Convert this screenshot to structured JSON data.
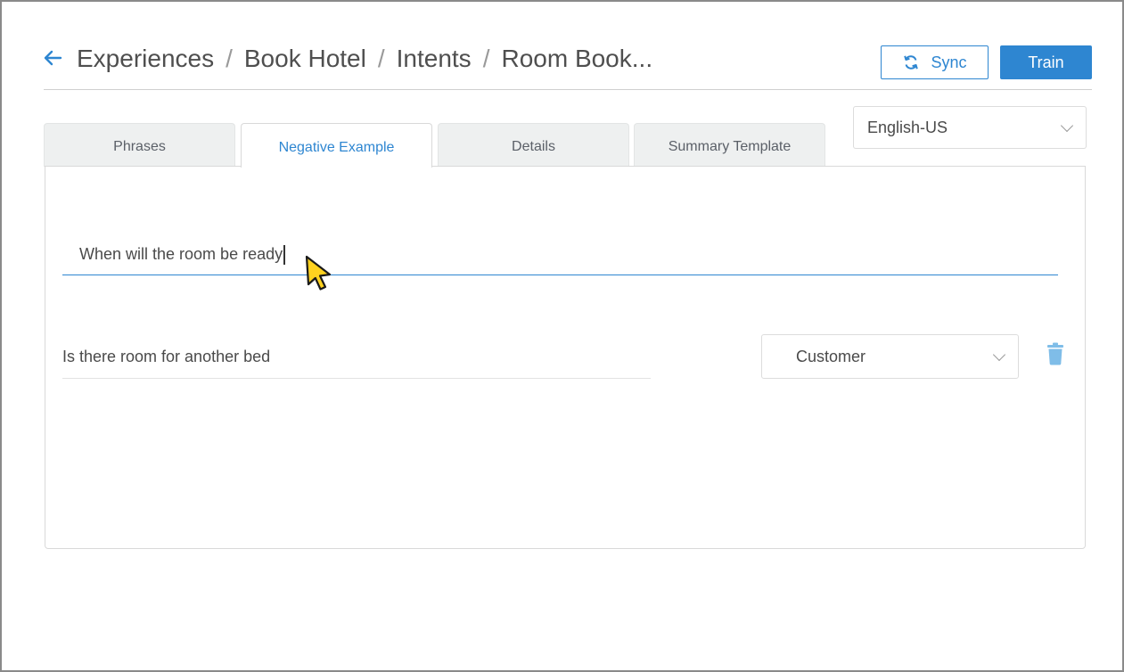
{
  "header": {
    "breadcrumb": [
      {
        "label": "Experiences"
      },
      {
        "label": "Book Hotel"
      },
      {
        "label": "Intents"
      },
      {
        "label": "Room Book..."
      }
    ],
    "separator": "/",
    "sync_label": "Sync",
    "train_label": "Train"
  },
  "tabs": [
    {
      "label": "Phrases",
      "active": false
    },
    {
      "label": "Negative Example",
      "active": true
    },
    {
      "label": "Details",
      "active": false
    },
    {
      "label": "Summary Template",
      "active": false
    }
  ],
  "language": {
    "selected": "English-US"
  },
  "negative_examples": {
    "new_input_value": "When will the room be ready",
    "items": [
      {
        "text": "Is there room for another bed",
        "role": "Customer"
      }
    ]
  },
  "icons": {
    "back": "arrow-left-icon",
    "sync": "refresh-icon",
    "delete": "trash-icon",
    "dropdown": "chevron-down-icon",
    "pointer": "mouse-pointer-icon"
  },
  "colors": {
    "accent": "#2e86d1",
    "tab_inactive_bg": "#eef0f0",
    "trash": "#7fbde8",
    "pointer": "#ffd21f"
  }
}
